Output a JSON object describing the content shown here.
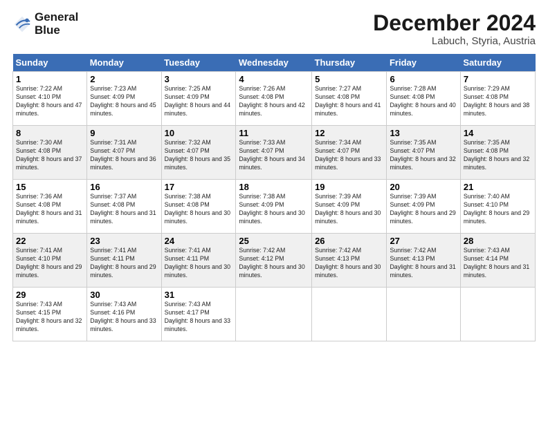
{
  "logo": {
    "line1": "General",
    "line2": "Blue"
  },
  "title": "December 2024",
  "subtitle": "Labuch, Styria, Austria",
  "days_of_week": [
    "Sunday",
    "Monday",
    "Tuesday",
    "Wednesday",
    "Thursday",
    "Friday",
    "Saturday"
  ],
  "weeks": [
    [
      {
        "day": "1",
        "sunrise": "Sunrise: 7:22 AM",
        "sunset": "Sunset: 4:10 PM",
        "daylight": "Daylight: 8 hours and 47 minutes."
      },
      {
        "day": "2",
        "sunrise": "Sunrise: 7:23 AM",
        "sunset": "Sunset: 4:09 PM",
        "daylight": "Daylight: 8 hours and 45 minutes."
      },
      {
        "day": "3",
        "sunrise": "Sunrise: 7:25 AM",
        "sunset": "Sunset: 4:09 PM",
        "daylight": "Daylight: 8 hours and 44 minutes."
      },
      {
        "day": "4",
        "sunrise": "Sunrise: 7:26 AM",
        "sunset": "Sunset: 4:08 PM",
        "daylight": "Daylight: 8 hours and 42 minutes."
      },
      {
        "day": "5",
        "sunrise": "Sunrise: 7:27 AM",
        "sunset": "Sunset: 4:08 PM",
        "daylight": "Daylight: 8 hours and 41 minutes."
      },
      {
        "day": "6",
        "sunrise": "Sunrise: 7:28 AM",
        "sunset": "Sunset: 4:08 PM",
        "daylight": "Daylight: 8 hours and 40 minutes."
      },
      {
        "day": "7",
        "sunrise": "Sunrise: 7:29 AM",
        "sunset": "Sunset: 4:08 PM",
        "daylight": "Daylight: 8 hours and 38 minutes."
      }
    ],
    [
      {
        "day": "8",
        "sunrise": "Sunrise: 7:30 AM",
        "sunset": "Sunset: 4:08 PM",
        "daylight": "Daylight: 8 hours and 37 minutes."
      },
      {
        "day": "9",
        "sunrise": "Sunrise: 7:31 AM",
        "sunset": "Sunset: 4:07 PM",
        "daylight": "Daylight: 8 hours and 36 minutes."
      },
      {
        "day": "10",
        "sunrise": "Sunrise: 7:32 AM",
        "sunset": "Sunset: 4:07 PM",
        "daylight": "Daylight: 8 hours and 35 minutes."
      },
      {
        "day": "11",
        "sunrise": "Sunrise: 7:33 AM",
        "sunset": "Sunset: 4:07 PM",
        "daylight": "Daylight: 8 hours and 34 minutes."
      },
      {
        "day": "12",
        "sunrise": "Sunrise: 7:34 AM",
        "sunset": "Sunset: 4:07 PM",
        "daylight": "Daylight: 8 hours and 33 minutes."
      },
      {
        "day": "13",
        "sunrise": "Sunrise: 7:35 AM",
        "sunset": "Sunset: 4:07 PM",
        "daylight": "Daylight: 8 hours and 32 minutes."
      },
      {
        "day": "14",
        "sunrise": "Sunrise: 7:35 AM",
        "sunset": "Sunset: 4:08 PM",
        "daylight": "Daylight: 8 hours and 32 minutes."
      }
    ],
    [
      {
        "day": "15",
        "sunrise": "Sunrise: 7:36 AM",
        "sunset": "Sunset: 4:08 PM",
        "daylight": "Daylight: 8 hours and 31 minutes."
      },
      {
        "day": "16",
        "sunrise": "Sunrise: 7:37 AM",
        "sunset": "Sunset: 4:08 PM",
        "daylight": "Daylight: 8 hours and 31 minutes."
      },
      {
        "day": "17",
        "sunrise": "Sunrise: 7:38 AM",
        "sunset": "Sunset: 4:08 PM",
        "daylight": "Daylight: 8 hours and 30 minutes."
      },
      {
        "day": "18",
        "sunrise": "Sunrise: 7:38 AM",
        "sunset": "Sunset: 4:09 PM",
        "daylight": "Daylight: 8 hours and 30 minutes."
      },
      {
        "day": "19",
        "sunrise": "Sunrise: 7:39 AM",
        "sunset": "Sunset: 4:09 PM",
        "daylight": "Daylight: 8 hours and 30 minutes."
      },
      {
        "day": "20",
        "sunrise": "Sunrise: 7:39 AM",
        "sunset": "Sunset: 4:09 PM",
        "daylight": "Daylight: 8 hours and 29 minutes."
      },
      {
        "day": "21",
        "sunrise": "Sunrise: 7:40 AM",
        "sunset": "Sunset: 4:10 PM",
        "daylight": "Daylight: 8 hours and 29 minutes."
      }
    ],
    [
      {
        "day": "22",
        "sunrise": "Sunrise: 7:41 AM",
        "sunset": "Sunset: 4:10 PM",
        "daylight": "Daylight: 8 hours and 29 minutes."
      },
      {
        "day": "23",
        "sunrise": "Sunrise: 7:41 AM",
        "sunset": "Sunset: 4:11 PM",
        "daylight": "Daylight: 8 hours and 29 minutes."
      },
      {
        "day": "24",
        "sunrise": "Sunrise: 7:41 AM",
        "sunset": "Sunset: 4:11 PM",
        "daylight": "Daylight: 8 hours and 30 minutes."
      },
      {
        "day": "25",
        "sunrise": "Sunrise: 7:42 AM",
        "sunset": "Sunset: 4:12 PM",
        "daylight": "Daylight: 8 hours and 30 minutes."
      },
      {
        "day": "26",
        "sunrise": "Sunrise: 7:42 AM",
        "sunset": "Sunset: 4:13 PM",
        "daylight": "Daylight: 8 hours and 30 minutes."
      },
      {
        "day": "27",
        "sunrise": "Sunrise: 7:42 AM",
        "sunset": "Sunset: 4:13 PM",
        "daylight": "Daylight: 8 hours and 31 minutes."
      },
      {
        "day": "28",
        "sunrise": "Sunrise: 7:43 AM",
        "sunset": "Sunset: 4:14 PM",
        "daylight": "Daylight: 8 hours and 31 minutes."
      }
    ],
    [
      {
        "day": "29",
        "sunrise": "Sunrise: 7:43 AM",
        "sunset": "Sunset: 4:15 PM",
        "daylight": "Daylight: 8 hours and 32 minutes."
      },
      {
        "day": "30",
        "sunrise": "Sunrise: 7:43 AM",
        "sunset": "Sunset: 4:16 PM",
        "daylight": "Daylight: 8 hours and 33 minutes."
      },
      {
        "day": "31",
        "sunrise": "Sunrise: 7:43 AM",
        "sunset": "Sunset: 4:17 PM",
        "daylight": "Daylight: 8 hours and 33 minutes."
      },
      null,
      null,
      null,
      null
    ]
  ]
}
